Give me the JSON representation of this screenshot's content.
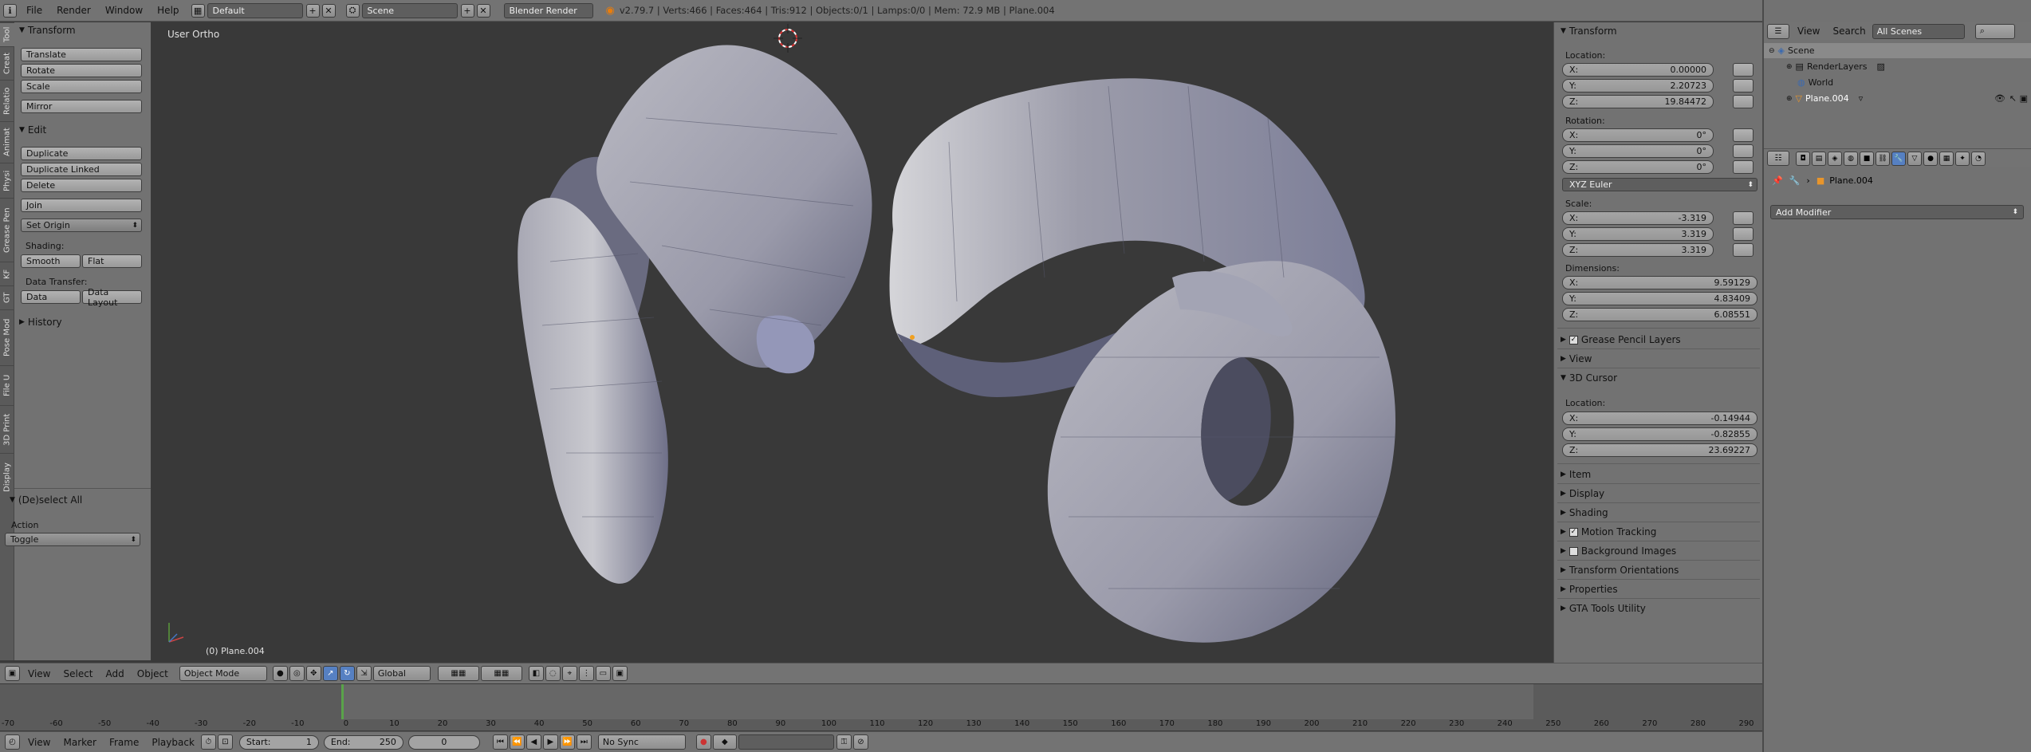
{
  "topbar": {
    "menus": [
      "File",
      "Render",
      "Window",
      "Help"
    ],
    "layout": "Default",
    "scene": "Scene",
    "engine": "Blender Render",
    "info": "v2.79.7 | Verts:466 | Faces:464 | Tris:912 | Objects:0/1 | Lamps:0/0 | Mem: 72.9 MB | Plane.004",
    "icons": [
      "info-icon",
      "screen-layout-icon",
      "scene-icon",
      "blender-logo-icon"
    ]
  },
  "left_tabs": [
    "Tool",
    "Creat",
    "Relatio",
    "Animat",
    "Physi",
    "Grease Pen",
    "KF",
    "GT",
    "Pose Mod",
    "File U",
    "3D Print",
    "Display"
  ],
  "toolshelf": {
    "transform": {
      "title": "Transform",
      "buttons": [
        "Translate",
        "Rotate",
        "Scale",
        "Mirror"
      ]
    },
    "edit": {
      "title": "Edit",
      "buttons": [
        "Duplicate",
        "Duplicate Linked",
        "Delete",
        "Join"
      ],
      "set_origin": "Set Origin",
      "shading_label": "Shading:",
      "smooth": "Smooth",
      "flat": "Flat",
      "data_transfer_label": "Data Transfer:",
      "data": "Data",
      "data_layout": "Data Layout"
    },
    "history": "History",
    "operator": {
      "title": "(De)select All",
      "action_label": "Action",
      "action_value": "Toggle"
    }
  },
  "viewport": {
    "view_label": "User Ortho",
    "object_label": "(0) Plane.004",
    "mesh_color": "#8f90a6"
  },
  "viewport_header": {
    "menus": [
      "View",
      "Select",
      "Add",
      "Object"
    ],
    "mode": "Object Mode",
    "orientation": "Global"
  },
  "timeline": {
    "ticks": [
      "-70",
      "-60",
      "-50",
      "-40",
      "-30",
      "-20",
      "-10",
      "0",
      "10",
      "20",
      "30",
      "40",
      "50",
      "60",
      "70",
      "80",
      "90",
      "100",
      "110",
      "120",
      "130",
      "140",
      "150",
      "160",
      "170",
      "180",
      "190",
      "200",
      "210",
      "220",
      "230",
      "240",
      "250",
      "260",
      "270",
      "280",
      "290"
    ],
    "current_frame": 0,
    "range_end": 250
  },
  "timeline_header": {
    "menus": [
      "View",
      "Marker",
      "Frame",
      "Playback"
    ],
    "start_label": "Start:",
    "start_value": "1",
    "end_label": "End:",
    "end_value": "250",
    "current": "0",
    "sync": "No Sync"
  },
  "npanel": {
    "transform_title": "Transform",
    "location_label": "Location:",
    "location": {
      "x": "0.00000",
      "y": "2.20723",
      "z": "19.84472"
    },
    "rotation_label": "Rotation:",
    "rotation": {
      "x": "0°",
      "y": "0°",
      "z": "0°"
    },
    "rotation_mode": "XYZ Euler",
    "scale_label": "Scale:",
    "scale": {
      "x": "-3.319",
      "y": "3.319",
      "z": "3.319"
    },
    "dimensions_label": "Dimensions:",
    "dimensions": {
      "x": "9.59129",
      "y": "4.83409",
      "z": "6.08551"
    },
    "axis": {
      "x": "X:",
      "y": "Y:",
      "z": "Z:"
    },
    "grease_pencil": "Grease Pencil Layers",
    "view": "View",
    "cursor_title": "3D Cursor",
    "cursor_location_label": "Location:",
    "cursor": {
      "x": "-0.14944",
      "y": "-0.82855",
      "z": "23.69227"
    },
    "collapsed": [
      "Item",
      "Display",
      "Shading"
    ],
    "motion_tracking": "Motion Tracking",
    "background_images": "Background Images",
    "transform_orientations": "Transform Orientations",
    "properties": "Properties",
    "gta_tools": "GTA Tools Utility"
  },
  "outliner": {
    "view": "View",
    "search": "Search",
    "filter": "All Scenes",
    "rows": [
      "Scene",
      "RenderLayers",
      "World",
      "Plane.004"
    ]
  },
  "properties_editor": {
    "object_name": "Plane.004",
    "add_modifier": "Add Modifier"
  }
}
